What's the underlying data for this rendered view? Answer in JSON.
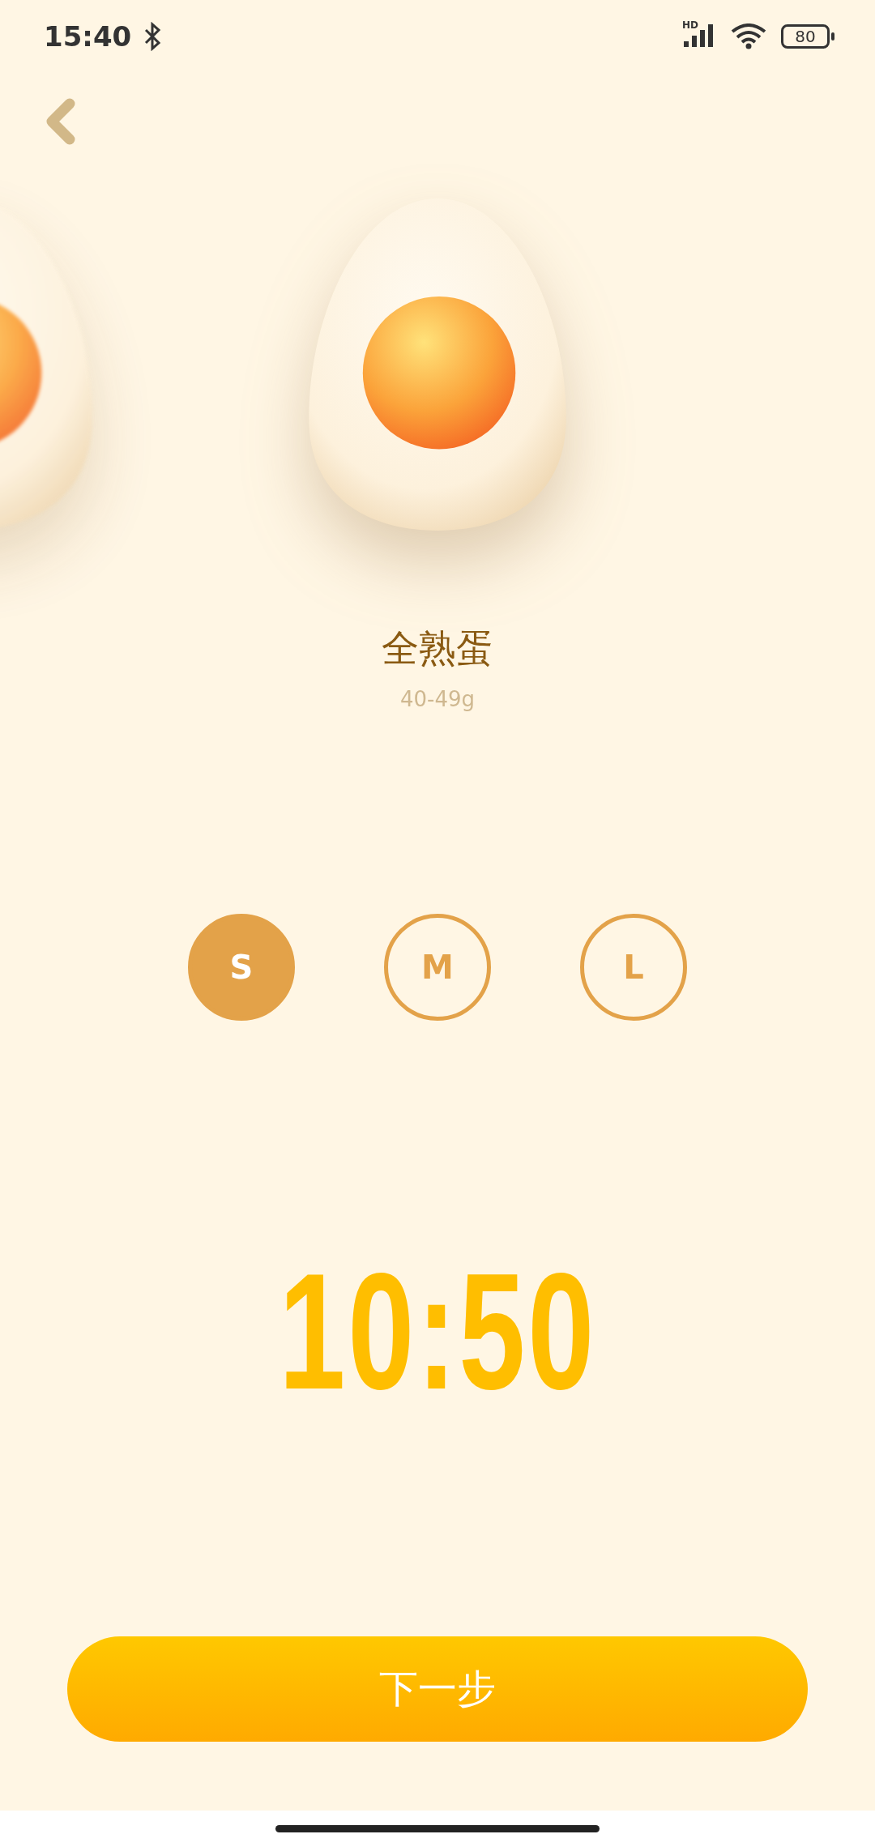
{
  "status_bar": {
    "time": "15:40",
    "network": "HD",
    "battery": "80"
  },
  "egg": {
    "name": "全熟蛋",
    "weight": "40-49g"
  },
  "sizes": [
    {
      "label": "S",
      "selected": true
    },
    {
      "label": "M",
      "selected": false
    },
    {
      "label": "L",
      "selected": false
    }
  ],
  "timer": "10:50",
  "next_button": "下一步"
}
